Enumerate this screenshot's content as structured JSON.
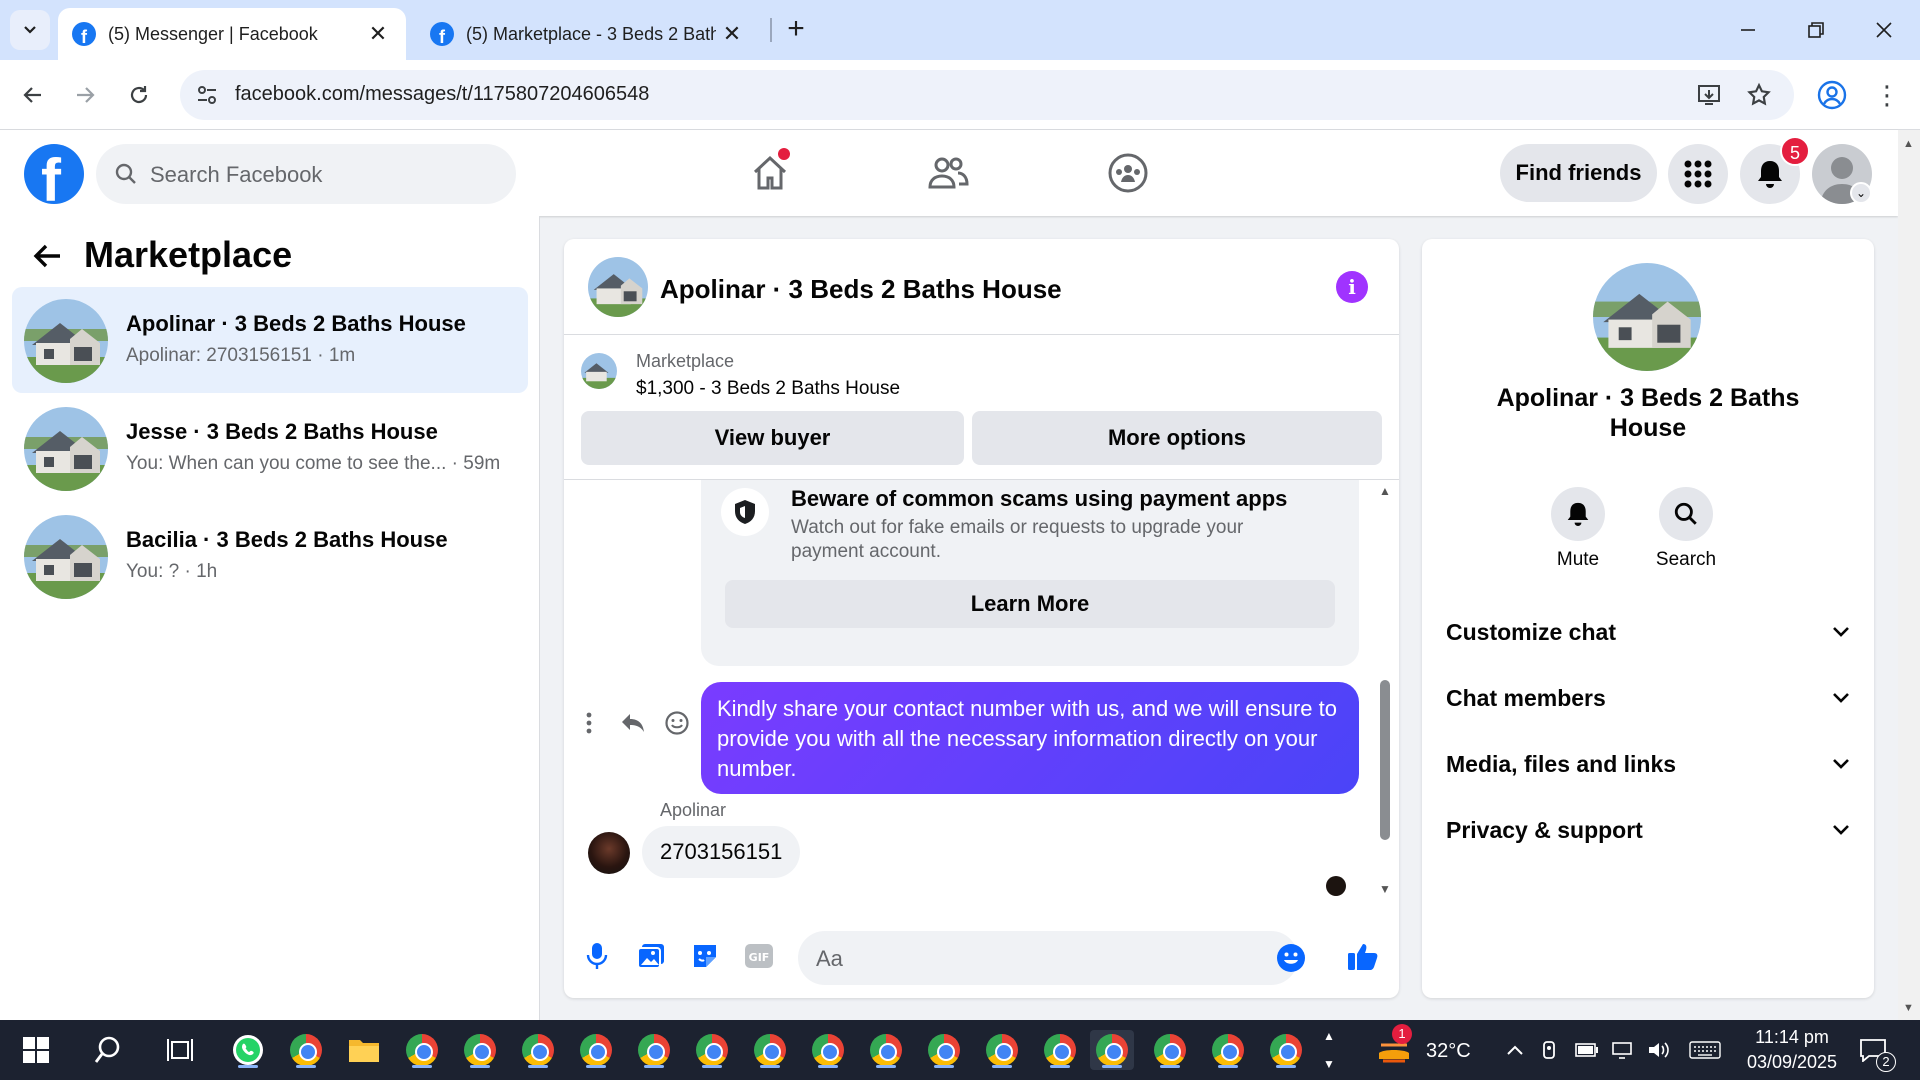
{
  "browser": {
    "tabs": [
      {
        "title": "(5) Messenger | Facebook",
        "active": true
      },
      {
        "title": "(5) Marketplace - 3 Beds 2 Bath",
        "active": false
      }
    ],
    "url": "facebook.com/messages/t/1175807204606548"
  },
  "fb_header": {
    "search_placeholder": "Search Facebook",
    "find_friends": "Find friends",
    "notification_count": "5"
  },
  "left": {
    "title": "Marketplace",
    "conversations": [
      {
        "name": "Apolinar · 3 Beds 2 Baths House",
        "preview": "Apolinar: 2703156151 · 1m",
        "active": true
      },
      {
        "name": "Jesse · 3 Beds 2 Baths House",
        "preview": "You: When can you come to see the... · 59m",
        "active": false
      },
      {
        "name": "Bacilia · 3 Beds 2 Baths House",
        "preview": "You: ? · 1h",
        "active": false
      }
    ]
  },
  "chat": {
    "title": "Apolinar · 3 Beds 2 Baths House",
    "marketplace_label": "Marketplace",
    "listing": "$1,300 - 3 Beds 2 Baths House",
    "view_buyer": "View buyer",
    "more_options": "More options",
    "warning_title": "Beware of common scams using payment apps",
    "warning_desc": "Watch out for fake emails or requests to upgrade your payment account.",
    "learn_more": "Learn More",
    "outgoing_message": "Kindly share your contact number with us, and we will ensure to provide you with all the necessary information directly on your number.",
    "sender_name": "Apolinar",
    "incoming_message": "2703156151",
    "composer_placeholder": "Aa"
  },
  "right": {
    "title": "Apolinar · 3 Beds 2 Baths House",
    "mute": "Mute",
    "search": "Search",
    "sections": [
      "Customize chat",
      "Chat members",
      "Media, files and links",
      "Privacy & support"
    ]
  },
  "taskbar": {
    "weather_badge": "1",
    "temperature": "32°C",
    "time": "11:14 pm",
    "date": "03/09/2025",
    "notification_count": "2"
  },
  "colors": {
    "facebook_blue": "#1877f2",
    "message_gradient_start": "#7a3cff",
    "message_gradient_end": "#4a44f8",
    "info_purple": "#a033ff",
    "badge_red": "#e41e3f"
  }
}
